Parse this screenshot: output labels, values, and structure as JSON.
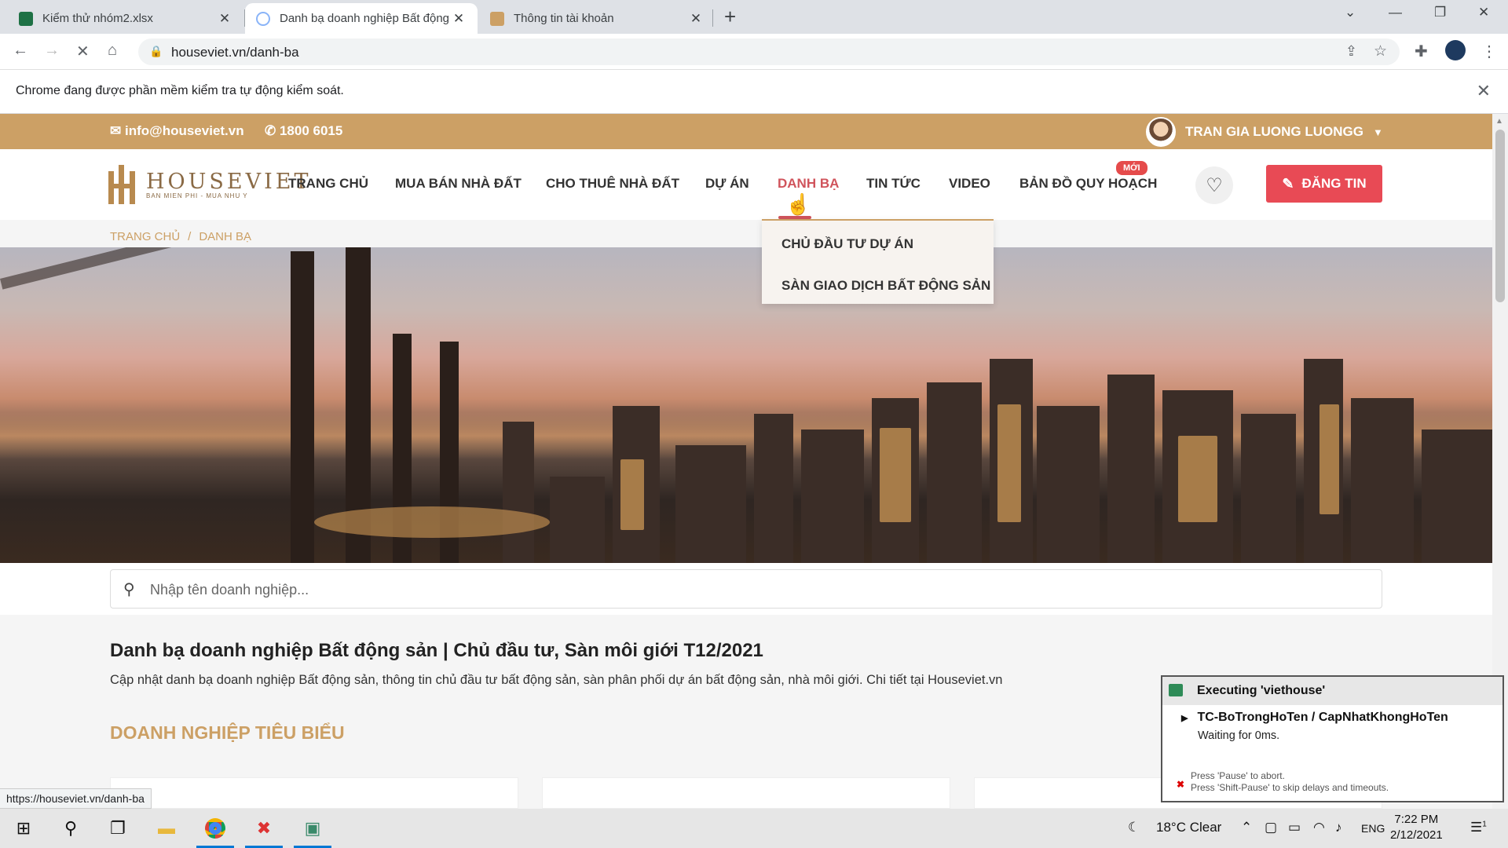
{
  "browser": {
    "tabs": [
      {
        "label": "Kiểm thử nhóm2.xlsx"
      },
      {
        "label": "Danh bạ doanh nghiệp Bất động"
      },
      {
        "label": "Thông tin tài khoản"
      }
    ],
    "url": "houseviet.vn/danh-ba",
    "infobar_message": "Chrome đang được phần mềm kiểm tra tự động kiểm soát."
  },
  "site": {
    "topbar": {
      "email": "info@houseviet.vn",
      "phone": "1800 6015",
      "user_name": "TRAN GIA LUONG LUONGG"
    },
    "logo": {
      "brand": "HOUSEVIET",
      "slogan": "BAN MIEN PHI - MUA NHU Y"
    },
    "nav": [
      {
        "label": "TRANG CHỦ"
      },
      {
        "label": "MUA BÁN NHÀ ĐẤT"
      },
      {
        "label": "CHO THUÊ NHÀ ĐẤT"
      },
      {
        "label": "DỰ ÁN"
      },
      {
        "label": "DANH BẠ"
      },
      {
        "label": "TIN TỨC"
      },
      {
        "label": "VIDEO"
      },
      {
        "label": "BẢN ĐỒ QUY HOẠCH"
      }
    ],
    "new_badge": "MỚI",
    "post_button": "ĐĂNG TIN",
    "dropdown": [
      {
        "label": "CHỦ ĐẦU TƯ DỰ ÁN"
      },
      {
        "label": "SÀN GIAO DỊCH BẤT ĐỘNG SẢN"
      }
    ],
    "breadcrumb": [
      "TRANG CHỦ",
      "/",
      "DANH BẠ"
    ],
    "search_placeholder": "Nhập tên doanh nghiệp...",
    "heading": "Danh bạ doanh nghiệp Bất động sản | Chủ đầu tư, Sàn môi giới T12/2021",
    "description": "Cập nhật danh bạ doanh nghiệp Bất động sản, thông tin chủ đầu tư bất động sản, sàn phân phối dự án bất động sản, nhà môi giới. Chi tiết tại Houseviet.vn",
    "section_title": "DOANH NGHIỆP TIÊU BIỂU",
    "accent_color": "#cca065",
    "active_color": "#d0545c"
  },
  "status_url": "https://houseviet.vn/danh-ba",
  "katalon": {
    "title": "Executing 'viethouse'",
    "test_case": "TC-BoTrongHoTen / CapNhatKhongHoTen",
    "waiting": "Waiting for 0ms.",
    "hint1": "Press 'Pause' to abort.",
    "hint2": "Press 'Shift-Pause' to skip delays and timeouts."
  },
  "taskbar": {
    "weather": "18°C  Clear",
    "lang": "ENG",
    "time": "7:22 PM",
    "date": "2/12/2021",
    "notif_count": "1"
  }
}
